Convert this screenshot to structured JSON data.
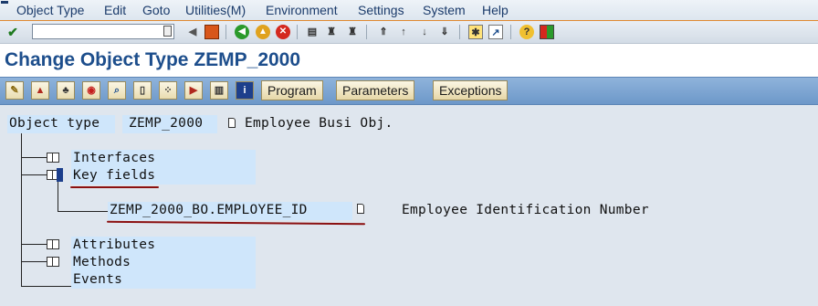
{
  "menu": {
    "items": [
      "Object Type",
      "Edit",
      "Goto",
      "Utilities(M)",
      "Environment",
      "Settings",
      "System",
      "Help"
    ]
  },
  "system_toolbar": {
    "command_field_value": "",
    "icons": [
      "enter-icon",
      "back-icon",
      "save-icon",
      "back-icon",
      "exit-icon",
      "cancel-icon",
      "print-icon",
      "find-icon",
      "find-next-icon",
      "first-page-icon",
      "previous-page-icon",
      "next-page-icon",
      "last-page-icon",
      "create-session-icon",
      "shortcut-icon",
      "help-icon",
      "layout-icon"
    ]
  },
  "title": "Change Object Type ZEMP_2000",
  "app_toolbar": {
    "icon_buttons": [
      "edit-icon",
      "hat-icon",
      "hierarchy-icon",
      "target-icon",
      "magnifier-icon",
      "new-doc-icon",
      "dots-icon",
      "forward-icon",
      "trash-icon",
      "info-icon"
    ],
    "program": "Program",
    "parameters": "Parameters",
    "exceptions": "Exceptions"
  },
  "tree": {
    "root_label": "Object type",
    "root_name": "ZEMP_2000",
    "root_desc": "Employee Busi Obj.",
    "nodes": {
      "interfaces": "Interfaces",
      "key_fields": "Key fields",
      "key_field_name": "ZEMP_2000_BO.EMPLOYEE_ID",
      "key_field_desc": "Employee Identification Number",
      "attributes": "Attributes",
      "methods": "Methods",
      "events": "Events"
    }
  },
  "colors": {
    "title": "#1d4e8c",
    "highlight": "#cfe6fb",
    "annotation": "#8b1010",
    "app_toolbar": "#7ea6d2"
  }
}
